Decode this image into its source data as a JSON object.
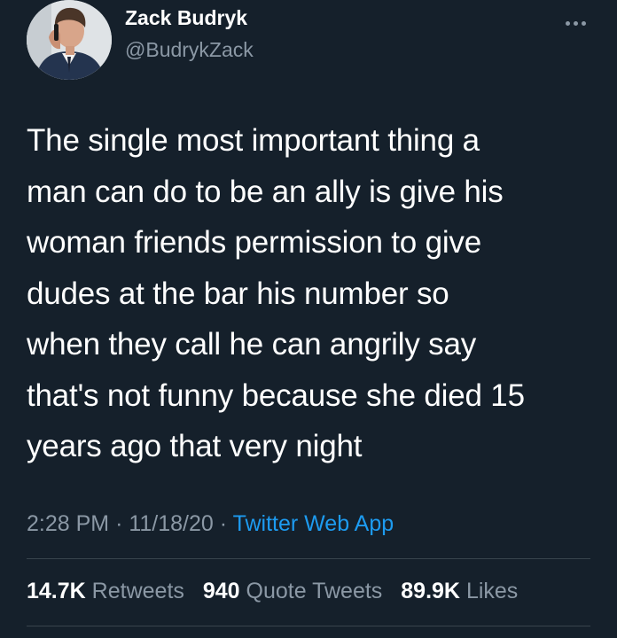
{
  "author": {
    "display_name": "Zack Budryk",
    "handle": "@BudrykZack",
    "avatar": "profile-photo"
  },
  "more_icon": "ellipsis-icon",
  "tweet": {
    "text": "The single most important thing a\nman can do to be an ally is give his\nwoman friends permission to give\ndudes at the bar his number so\nwhen they call he can angrily say\nthat's not funny because she died 15\nyears ago that very night"
  },
  "meta": {
    "time": "2:28 PM",
    "separator": "·",
    "date": "11/18/20",
    "source": "Twitter Web App"
  },
  "stats": {
    "retweets": {
      "count": "14.7K",
      "label": "Retweets"
    },
    "quote_tweets": {
      "count": "940",
      "label": "Quote Tweets"
    },
    "likes": {
      "count": "89.9K",
      "label": "Likes"
    }
  },
  "colors": {
    "background": "#15202b",
    "primary_text": "#ffffff",
    "secondary_text": "#8b98a5",
    "link": "#1d9bf0",
    "divider": "#38444d"
  }
}
